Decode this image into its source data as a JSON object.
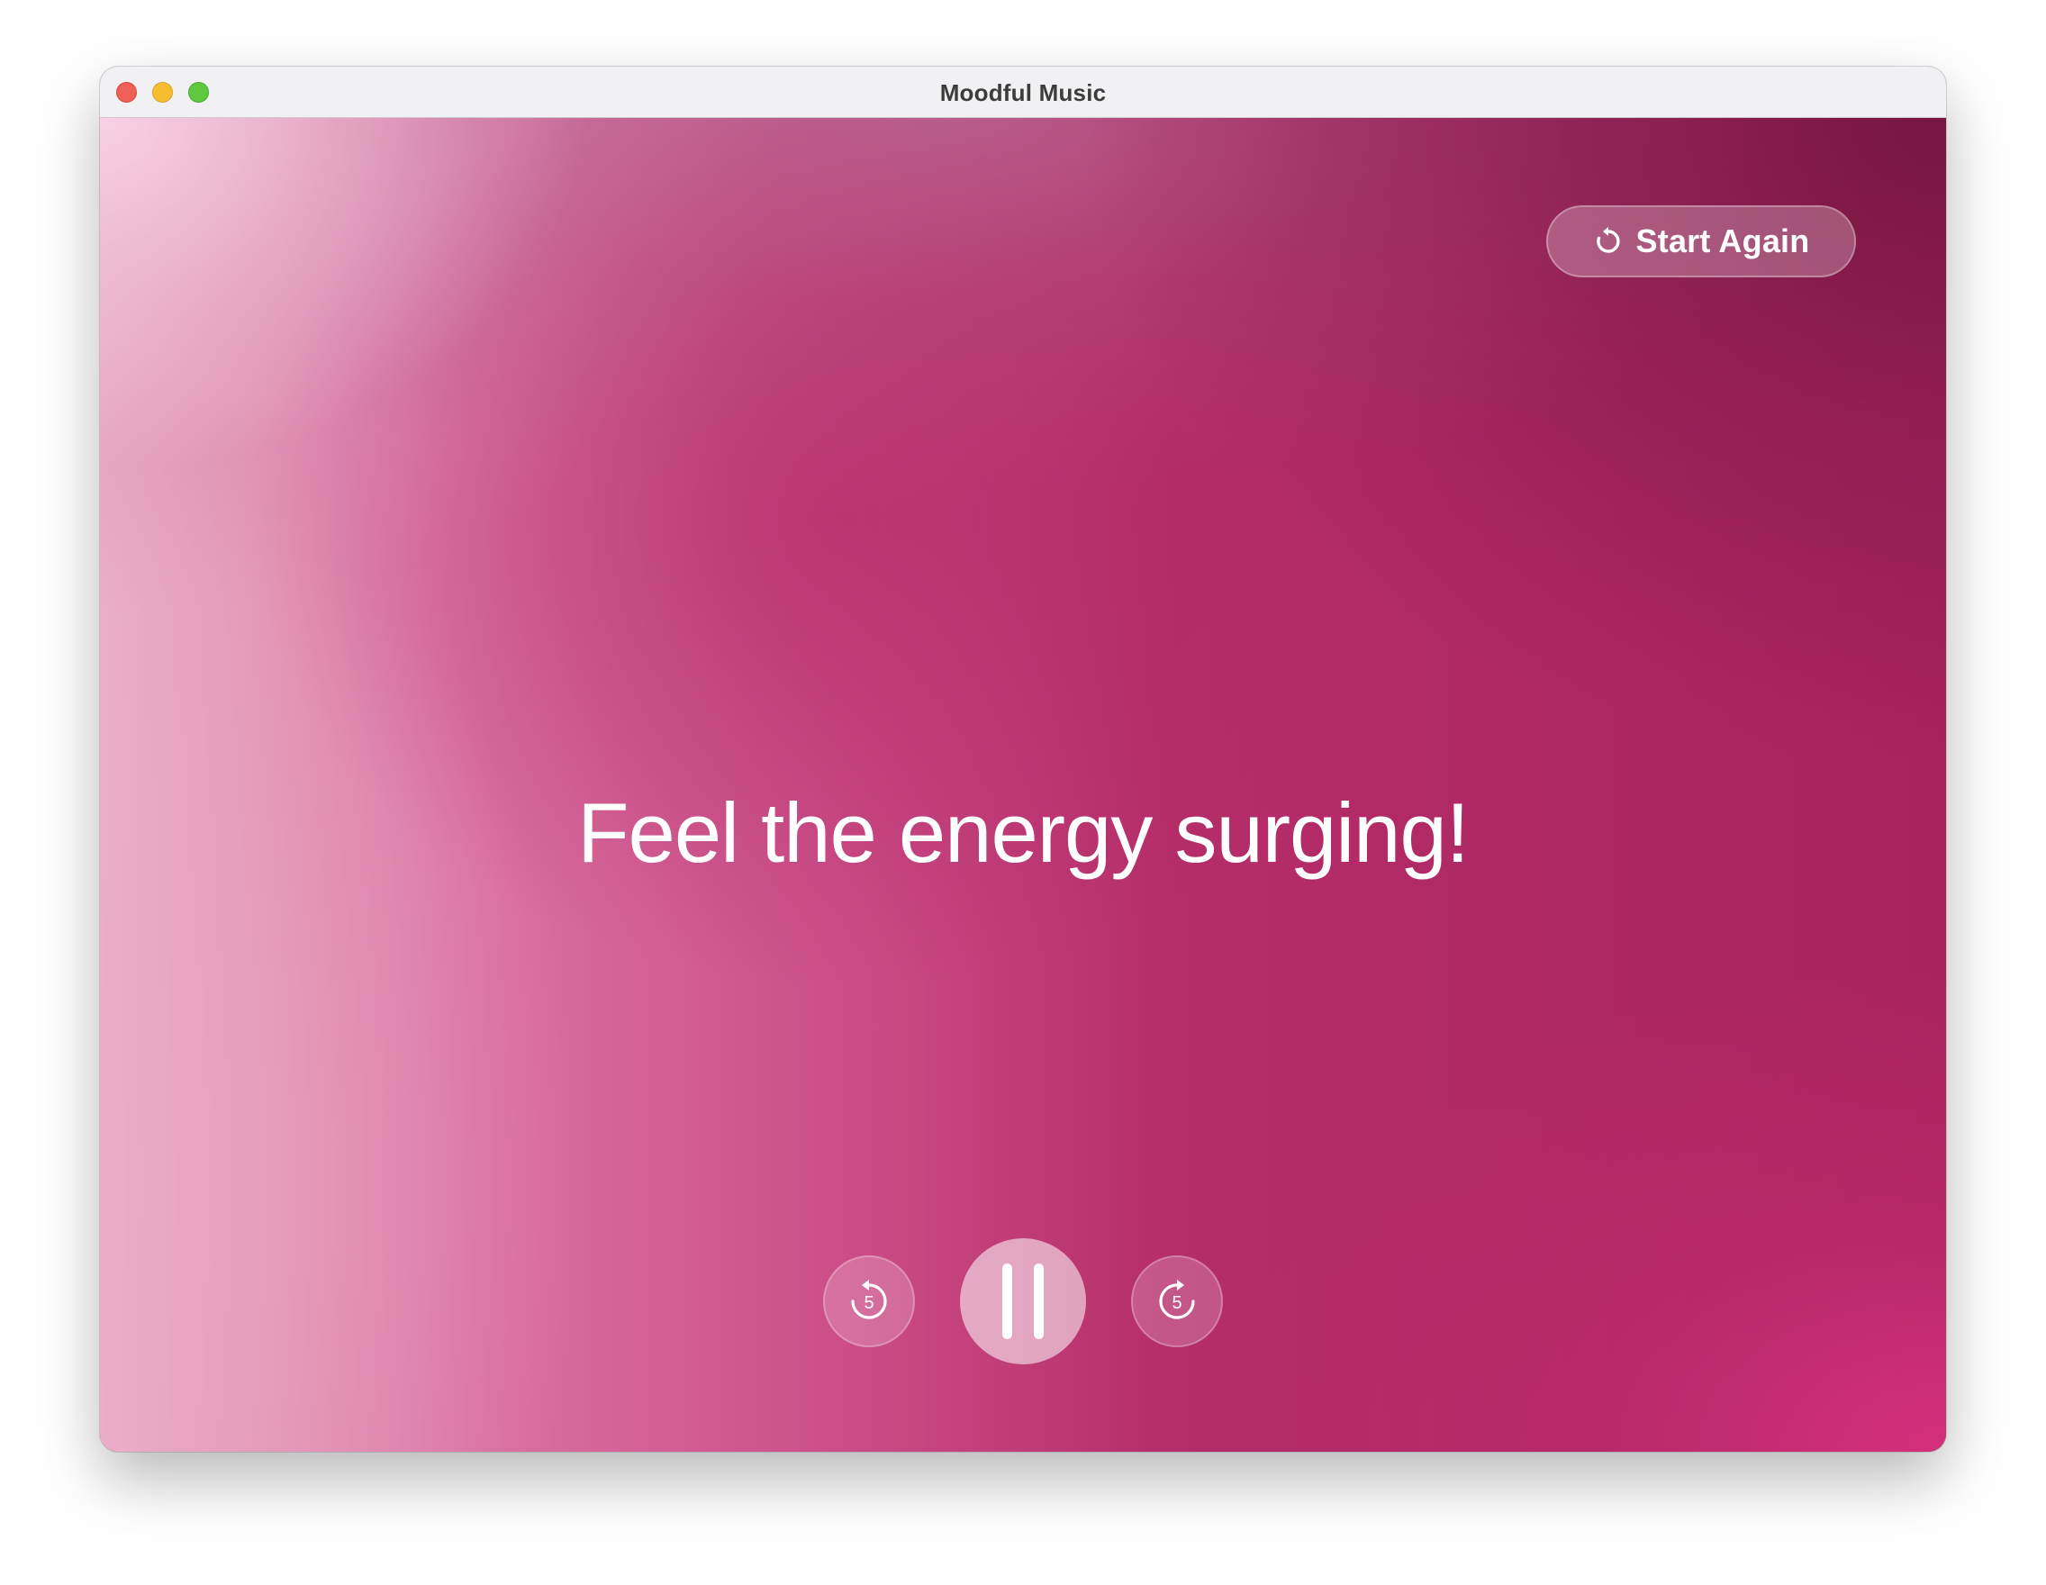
{
  "window": {
    "title": "Moodful Music"
  },
  "controls": {
    "start_again_label": "Start Again",
    "skip_back_seconds": "5",
    "skip_forward_seconds": "5"
  },
  "mood": {
    "message": "Feel the energy surging!"
  },
  "icons": {
    "start_again": "restart-arrow-icon",
    "skip_back": "gobackward-5-icon",
    "skip_forward": "goforward-5-icon",
    "play_state": "pause-icon"
  },
  "colors": {
    "accent": "#b22e6a",
    "pale": "#f0c3d8",
    "hot": "#d33377",
    "dark": "#7a1a48"
  }
}
